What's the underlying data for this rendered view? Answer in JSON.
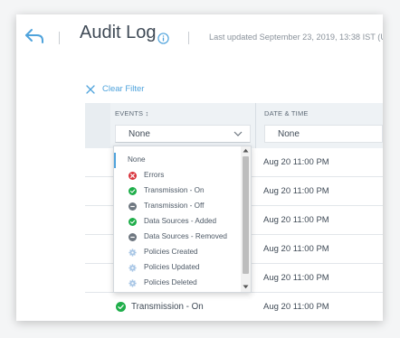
{
  "header": {
    "title": "Audit Log",
    "last_updated": "Last updated September 23, 2019, 13:38 IST (U"
  },
  "toolbar": {
    "clear_filter_label": "Clear Filter"
  },
  "table": {
    "columns": [
      {
        "label": "EVENTS ↕",
        "filter_value": "None"
      },
      {
        "label": "DATE & TIME",
        "filter_value": "None"
      }
    ],
    "rows": [
      {
        "date": "Aug 20 11:00 PM"
      },
      {
        "date": "Aug 20 11:00 PM"
      },
      {
        "date": "Aug 20 11:00 PM"
      },
      {
        "date": "Aug 20 11:00 PM"
      },
      {
        "date": "Aug 20 11:00 PM"
      },
      {
        "date": "Aug 20 11:00 PM",
        "event": "Transmission - On",
        "event_status": "success"
      }
    ]
  },
  "events_dropdown": {
    "options": [
      {
        "label": "None",
        "icon": "none",
        "selected": true
      },
      {
        "label": "Errors",
        "icon": "error-icon"
      },
      {
        "label": "Transmission - On",
        "icon": "check-circle-icon"
      },
      {
        "label": "Transmission - Off",
        "icon": "minus-circle-icon"
      },
      {
        "label": "Data Sources - Added",
        "icon": "check-circle-icon"
      },
      {
        "label": "Data Sources - Removed",
        "icon": "minus-circle-icon"
      },
      {
        "label": "Policies Created",
        "icon": "gear-icon"
      },
      {
        "label": "Policies Updated",
        "icon": "gear-icon"
      },
      {
        "label": "Policies Deleted",
        "icon": "gear-icon"
      }
    ]
  },
  "colors": {
    "accent": "#4fa3dc",
    "success": "#1fae4a",
    "error": "#d9363e",
    "neutral": "#6e7780",
    "policy": "#a9c7e6"
  }
}
